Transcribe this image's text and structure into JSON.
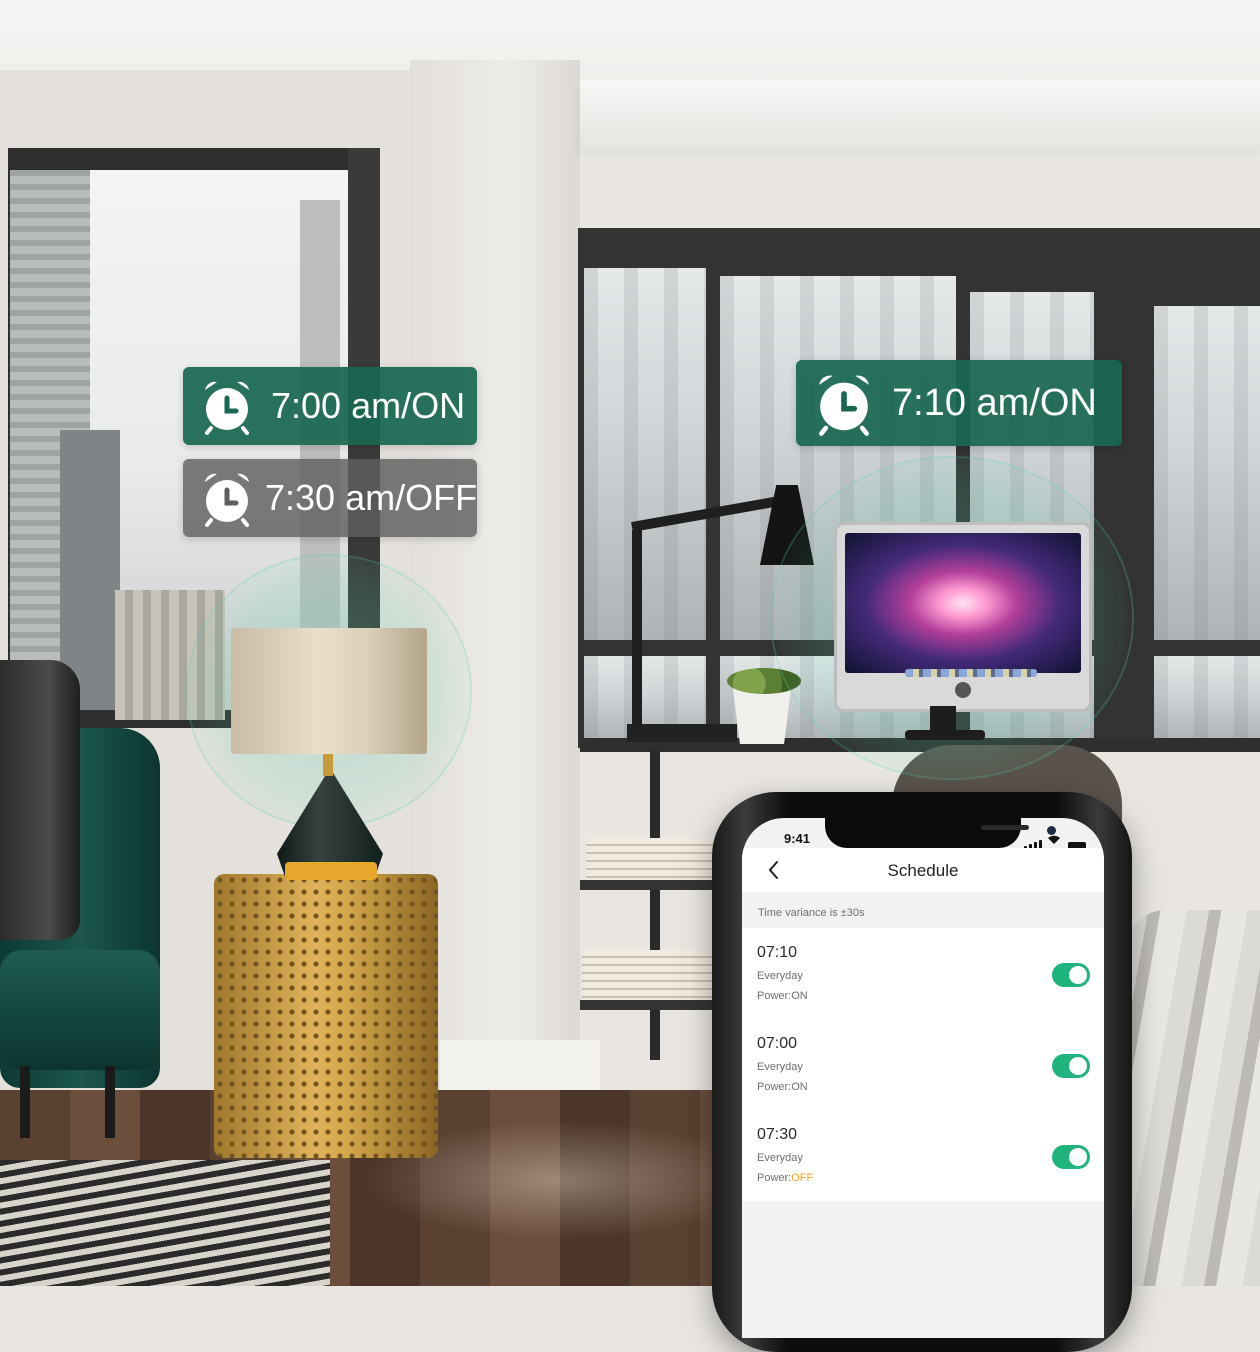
{
  "colors": {
    "tag_on": "#196752",
    "tag_off": "#5f5f5f",
    "toggle_on": "#1fb47e",
    "power_off_text": "#f0a21a"
  },
  "callouts": [
    {
      "text": "7:00 am/ON",
      "state": "on",
      "icon": "alarm-clock-icon"
    },
    {
      "text": "7:30 am/OFF",
      "state": "off",
      "icon": "alarm-clock-icon"
    },
    {
      "text": "7:10 am/ON",
      "state": "on",
      "icon": "alarm-clock-icon"
    }
  ],
  "phone": {
    "status_time": "9:41",
    "status_icons": [
      "signal-icon",
      "wifi-icon",
      "battery-icon"
    ],
    "nav": {
      "title": "Schedule",
      "back_icon": "chevron-left-icon"
    },
    "note": "Time variance is ±30s",
    "schedules": [
      {
        "time": "07:10",
        "repeat": "Everyday",
        "power_label": "Power:",
        "power_value": "ON",
        "enabled": true
      },
      {
        "time": "07:00",
        "repeat": "Everyday",
        "power_label": "Power:",
        "power_value": "ON",
        "enabled": true
      },
      {
        "time": "07:30",
        "repeat": "Everyday",
        "power_label": "Power:",
        "power_value": "OFF",
        "enabled": true
      }
    ]
  }
}
